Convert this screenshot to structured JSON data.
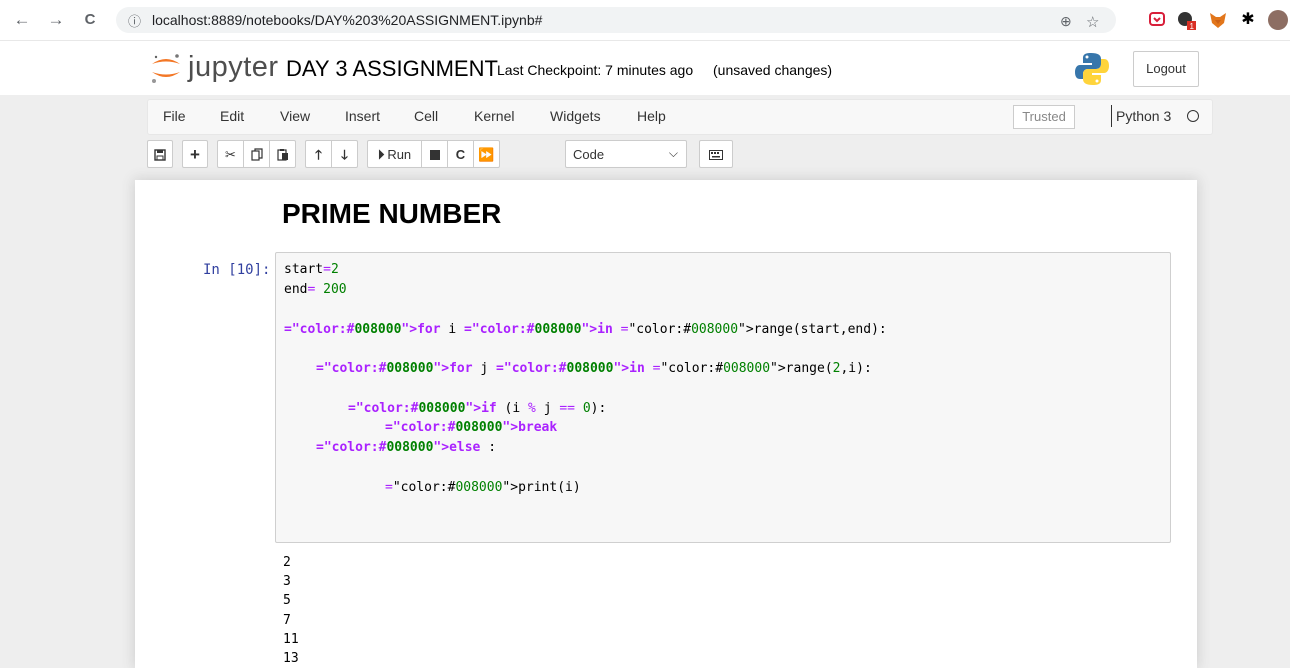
{
  "browser": {
    "back": "←",
    "forward": "→",
    "reload": "C",
    "info": "ⓘ",
    "url": "localhost:8889/notebooks/DAY%203%20ASSIGNMENT.ipynb#"
  },
  "header": {
    "wordmark": "jupyter",
    "notebook_name": "DAY 3 ASSIGNMENT",
    "checkpoint": "Last Checkpoint: 7 minutes ago",
    "autosave": "(unsaved changes)",
    "logout_label": "Logout"
  },
  "menu": {
    "items": [
      "File",
      "Edit",
      "View",
      "Insert",
      "Cell",
      "Kernel",
      "Widgets",
      "Help"
    ],
    "trusted": "Trusted",
    "kernel": "Python 3"
  },
  "toolbar": {
    "run_label": "Run",
    "cell_type": "Code"
  },
  "cells": {
    "markdown_heading": "PRIME NUMBER",
    "prompt": "In [10]:",
    "code_lines": {
      "l1": "start=2",
      "l2": "end= 200",
      "l3": "for i in range(start,end):",
      "l4": "for j in range(2,i):",
      "l5": "if (i % j == 0):",
      "l6": "break",
      "l7": "else :",
      "l8": "print(i)"
    },
    "output": [
      "2",
      "3",
      "5",
      "7",
      "11",
      "13"
    ]
  },
  "colors": {
    "keyword": "#008000",
    "number": "#008000",
    "operator": "#aa22ff",
    "prompt": "#303f9f"
  },
  "icons": {
    "zoom": "zoom-icon",
    "star": "bookmark-star-icon",
    "extensions": "puzzle-icon"
  }
}
